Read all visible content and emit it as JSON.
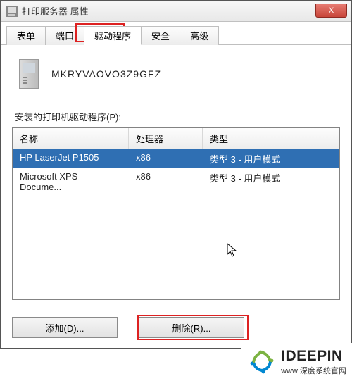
{
  "titlebar": {
    "title": "打印服务器 属性",
    "close_label": "X"
  },
  "tabs": [
    {
      "label": "表单"
    },
    {
      "label": "端口"
    },
    {
      "label": "驱动程序",
      "active": true,
      "highlighted": true
    },
    {
      "label": "安全"
    },
    {
      "label": "高级"
    }
  ],
  "server": {
    "name": "MKRYVAOVO3Z9GFZ"
  },
  "section": {
    "installed_drivers_label": "安装的打印机驱动程序(P):"
  },
  "columns": {
    "name": "名称",
    "processor": "处理器",
    "type": "类型"
  },
  "drivers": [
    {
      "name": "HP LaserJet P1505",
      "processor": "x86",
      "type": "类型 3 - 用户模式",
      "selected": true
    },
    {
      "name": "Microsoft XPS Docume...",
      "processor": "x86",
      "type": "类型 3 - 用户模式",
      "selected": false
    }
  ],
  "buttons": {
    "add": "添加(D)...",
    "remove": "删除(R)..."
  },
  "watermark": {
    "brand": "IDEEPIN",
    "subtitle": "www 深度系统官网"
  }
}
